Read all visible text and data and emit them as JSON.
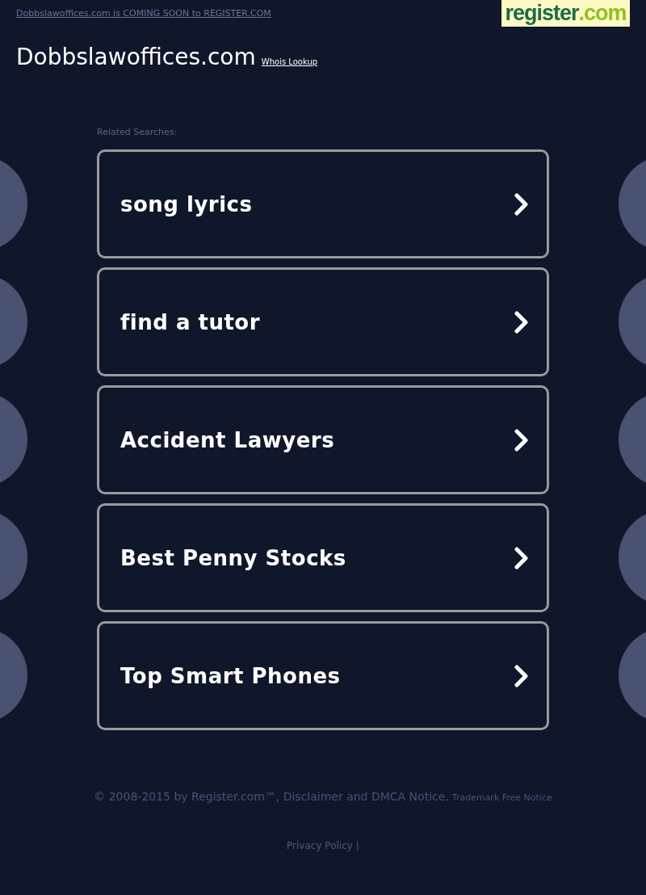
{
  "top_link": "Dobbslawoffices.com is COMING SOON to REGISTER.COM",
  "logo": {
    "name": "register",
    "suffix": ".com"
  },
  "site_title": "Dobbslawoffices.com",
  "whois_link": "Whois Lookup",
  "related_label": "Related Searches:",
  "searches": [
    {
      "label": "song lyrics"
    },
    {
      "label": "find a tutor"
    },
    {
      "label": "Accident Lawyers"
    },
    {
      "label": "Best Penny Stocks"
    },
    {
      "label": "Top Smart Phones"
    }
  ],
  "footer": {
    "copyright": "© 2008-2015 by Register.com™, Disclaimer and DMCA Notice.",
    "trademark": "Trademark Free Notice",
    "privacy": "Privacy Policy",
    "separator": "|"
  }
}
